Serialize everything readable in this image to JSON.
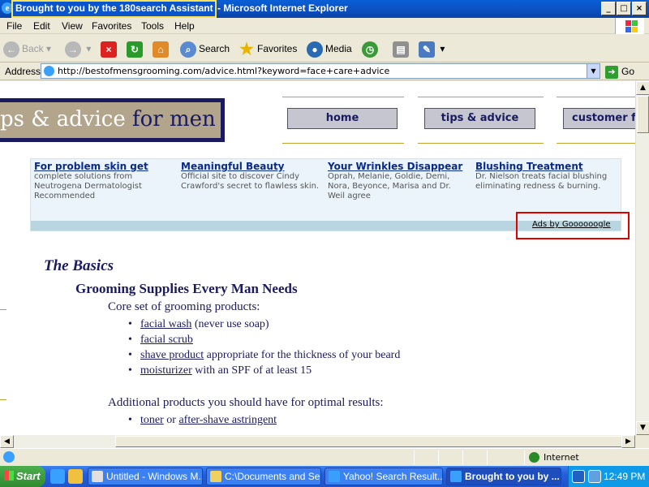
{
  "window": {
    "title_highlight": "Brought to you by the 180search Assistant",
    "title_suffix": "- Microsoft Internet Explorer",
    "min": "_",
    "max": "□",
    "close": "×"
  },
  "menu": [
    "File",
    "Edit",
    "View",
    "Favorites",
    "Tools",
    "Help"
  ],
  "toolbar": {
    "back": "Back",
    "search": "Search",
    "favorites": "Favorites",
    "media": "Media"
  },
  "address": {
    "label": "Address",
    "url": "http://bestofmensgrooming.com/advice.html?keyword=face+care+advice",
    "go": "Go"
  },
  "page": {
    "banner": {
      "part1": "ps & advice",
      "part2": "for men"
    },
    "nav": [
      "home",
      "tips & advice",
      "customer fa"
    ],
    "ads": [
      {
        "title": "For problem skin get",
        "desc": "complete solutions from Neutrogena Dermatologist Recommended"
      },
      {
        "title": "Meaningful Beauty",
        "desc": "Official site to discover Cindy Crawford's secret to flawless skin."
      },
      {
        "title": "Your Wrinkles Disappear",
        "desc": "Oprah, Melanie, Goldie, Demi, Nora, Beyonce, Marisa and Dr. Weil agree"
      },
      {
        "title": "Blushing Treatment",
        "desc": "Dr. Nielson treats facial blushing eliminating redness & burning."
      }
    ],
    "ads_by": "Ads by Goooooogle",
    "basics_heading": "The Basics",
    "grooming_heading": "Grooming Supplies Every Man Needs",
    "core_heading": "Core set of grooming products:",
    "core_items": [
      {
        "link": "facial wash",
        "rest": " (never use soap)"
      },
      {
        "link": "facial scrub",
        "rest": ""
      },
      {
        "link": "shave product",
        "rest": " appropriate for the thickness of your beard"
      },
      {
        "link": "moisturizer",
        "rest": " with an SPF of at least 15"
      }
    ],
    "additional_heading": "Additional products you should have for optimal results:",
    "additional_items": [
      {
        "link": "toner",
        "mid": " or ",
        "link2": "after-shave astringent"
      }
    ]
  },
  "status": {
    "zone": "Internet"
  },
  "taskbar": {
    "start": "Start",
    "tasks": [
      "Untitled - Windows M...",
      "C:\\Documents and Se...",
      "Yahoo! Search Result...",
      "Brought to you by ..."
    ],
    "clock": "12:49 PM"
  },
  "colors": {
    "title_bar": "#0a55cc",
    "highlight_border": "#f7e25a",
    "page_navy": "#1a1a60",
    "ads_box_border": "#e00000"
  }
}
